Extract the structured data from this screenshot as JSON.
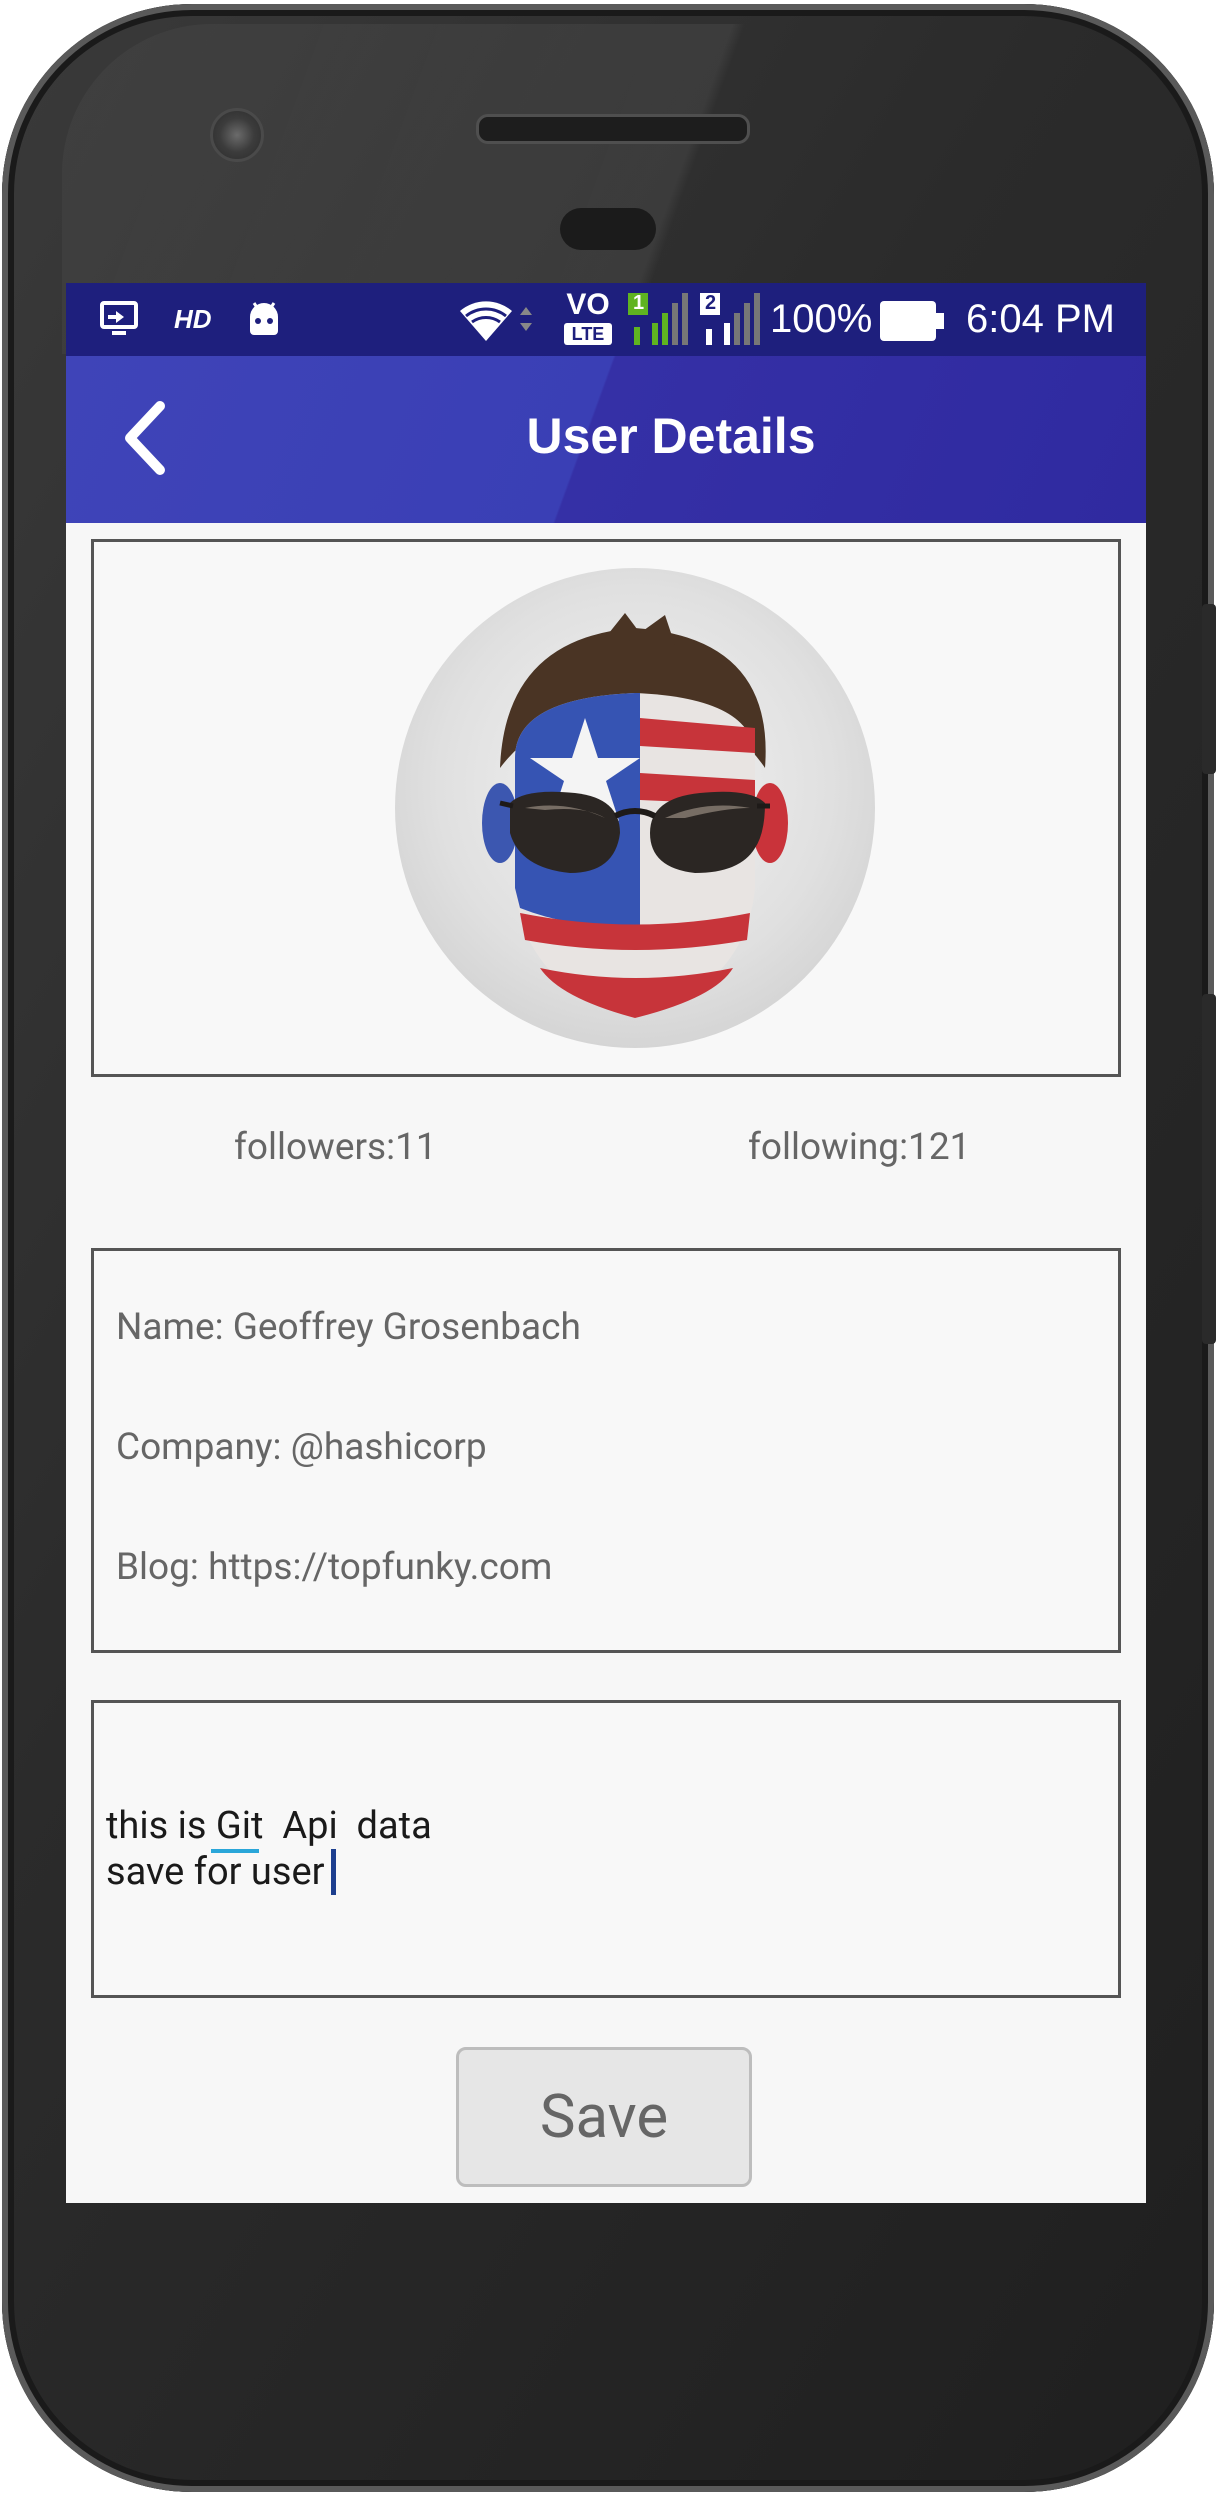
{
  "status_bar": {
    "battery_percent": "100%",
    "time": "6:04 PM",
    "hd_label": "HD",
    "volte_label": "VO",
    "lte_label": "LTE",
    "sim1_label": "1",
    "sim2_label": "2",
    "icons": [
      "cast-icon",
      "hd-icon",
      "android-debug-icon",
      "wifi-icon",
      "volte-icon",
      "signal-sim1-icon",
      "signal-sim2-icon",
      "battery-icon"
    ],
    "background": "#1e1f7d"
  },
  "app_bar": {
    "title": "User Details",
    "back_icon": "chevron-left-icon",
    "background": "#3a3fb5"
  },
  "profile": {
    "followers": "followers:11",
    "following": "following:121"
  },
  "details": {
    "name": "Name: Geoffrey Grosenbach",
    "company": "Company: @hashicorp",
    "blog": "Blog: https://topfunky.com"
  },
  "note": {
    "line1": "this is Git  Api  data",
    "line2": "save for user"
  },
  "actions": {
    "save_label": "Save"
  }
}
